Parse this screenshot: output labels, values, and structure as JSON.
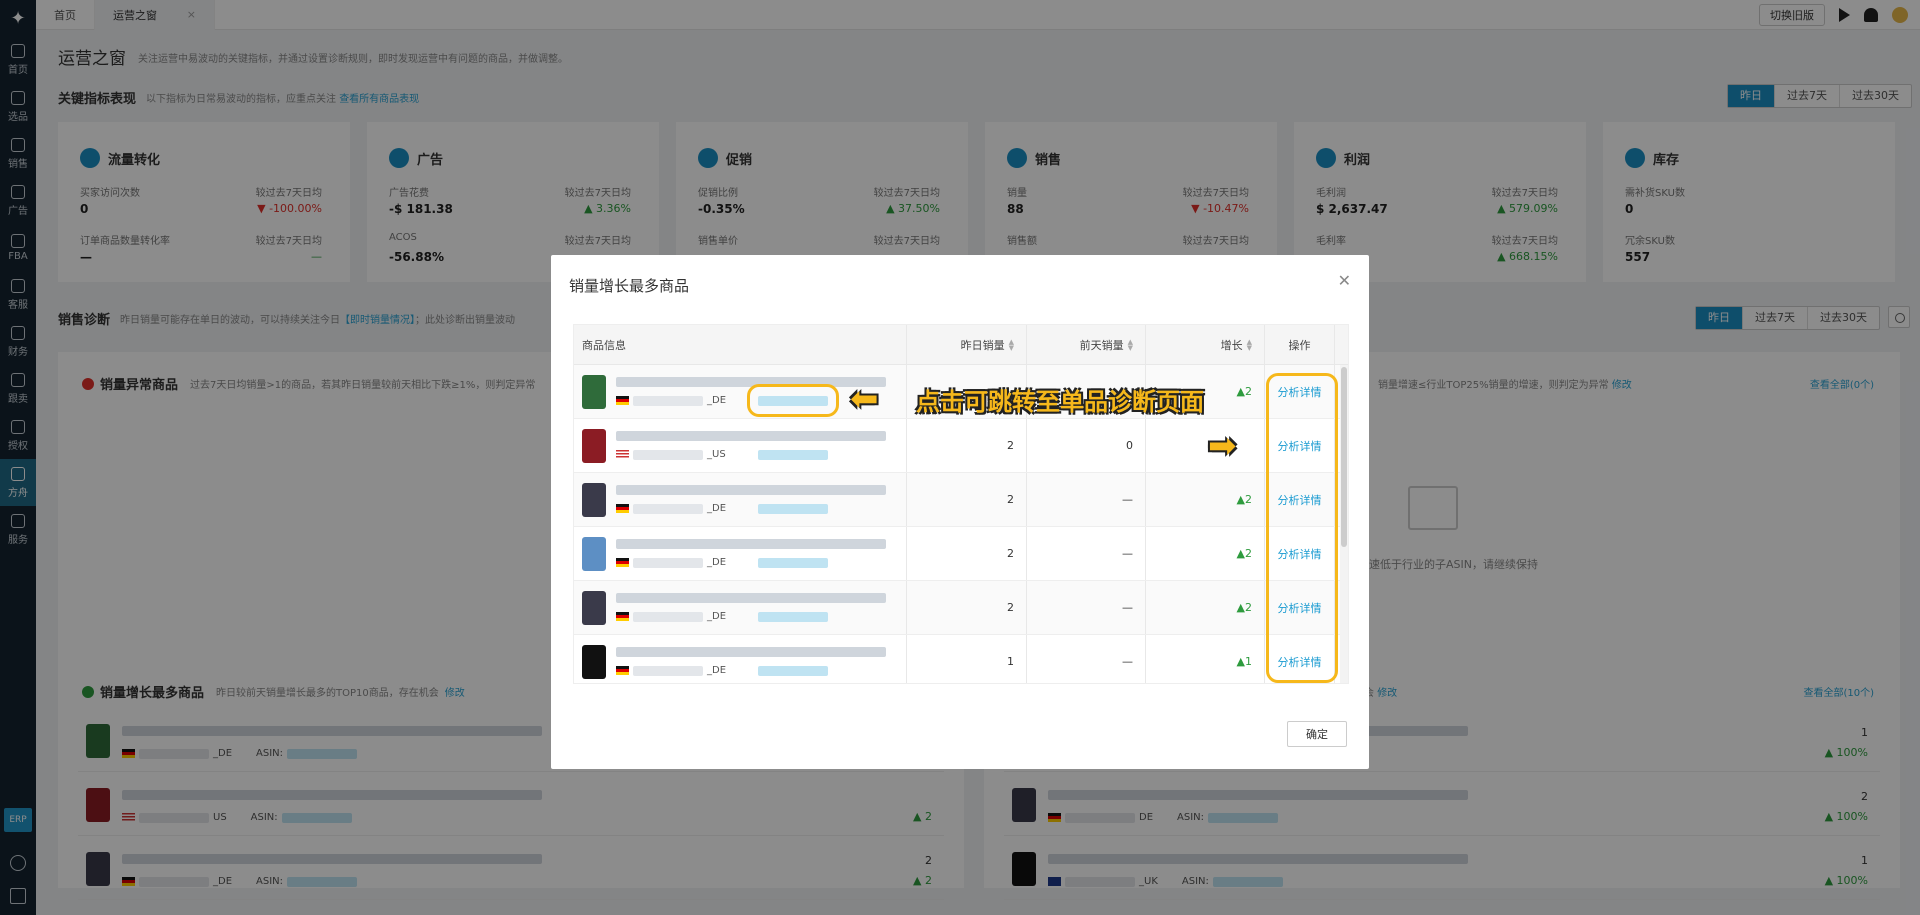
{
  "nav": {
    "items": [
      {
        "label": "首页"
      },
      {
        "label": "选品"
      },
      {
        "label": "销售"
      },
      {
        "label": "广告"
      },
      {
        "label": "FBA"
      },
      {
        "label": "客服"
      },
      {
        "label": "财务"
      },
      {
        "label": "跟卖"
      },
      {
        "label": "授权"
      },
      {
        "label": "方舟"
      },
      {
        "label": "服务"
      }
    ],
    "erp": "ERP"
  },
  "tabs": [
    {
      "label": "首页"
    },
    {
      "label": "运营之窗"
    }
  ],
  "topbar": {
    "switch_label": "切换旧版"
  },
  "page": {
    "title": "运营之窗",
    "desc": "关注运营中易波动的关键指标，并通过设置诊断规则，即时发现运营中有问题的商品，并做调整。"
  },
  "kpi_section": {
    "title": "关键指标表现",
    "desc": "以下指标为日常易波动的指标，应重点关注",
    "link": "查看所有商品表现",
    "periods": [
      "昨日",
      "过去7天",
      "过去30天"
    ]
  },
  "kpis": [
    {
      "name": "流量转化",
      "icon": "traffic-icon",
      "r1l": "买家访问次数",
      "r1r": "较过去7天日均",
      "v1": "0",
      "c1": "-100.00%",
      "c1dir": "down",
      "r2l": "订单商品数量转化率",
      "r2r": "较过去7天日均",
      "v2": "—",
      "c2": "—"
    },
    {
      "name": "广告",
      "icon": "ad-icon",
      "r1l": "广告花费",
      "r1r": "较过去7天日均",
      "v1": "-$ 181.38",
      "c1": "3.36%",
      "c1dir": "up",
      "r2l": "ACOS",
      "r2r": "较过去7天日均",
      "v2": "-56.88%",
      "c2": ""
    },
    {
      "name": "促销",
      "icon": "promo-icon",
      "r1l": "促销比例",
      "r1r": "较过去7天日均",
      "v1": "-0.35%",
      "c1": "37.50%",
      "c1dir": "up",
      "r2l": "销售单价",
      "r2r": "较过去7天日均",
      "v2": "",
      "c2": ""
    },
    {
      "name": "销售",
      "icon": "sale-icon",
      "r1l": "销量",
      "r1r": "较过去7天日均",
      "v1": "88",
      "c1": "-10.47%",
      "c1dir": "down",
      "r2l": "销售额",
      "r2r": "较过去7天日均",
      "v2": "",
      "c2": ""
    },
    {
      "name": "利润",
      "icon": "profit-icon",
      "r1l": "毛利润",
      "r1r": "较过去7天日均",
      "v1": "$ 2,637.47",
      "c1": "579.09%",
      "c1dir": "up",
      "r2l": "毛利率",
      "r2r": "较过去7天日均",
      "v2": "",
      "c2": "668.15%"
    },
    {
      "name": "库存",
      "icon": "inventory-icon",
      "r1l": "需补货SKU数",
      "r1r": "",
      "v1": "0",
      "c1": "",
      "c1dir": "",
      "r2l": "冗余SKU数",
      "r2r": "",
      "v2": "557",
      "c2": ""
    }
  ],
  "diag_section": {
    "title": "销售诊断",
    "desc": "昨日销量可能存在单日的波动，可以持续关注今日",
    "link": "【即时销量情况】",
    "desc2": "；此处诊断出销量波动",
    "periods": [
      "昨日",
      "过去7天",
      "过去30天"
    ]
  },
  "abnormal": {
    "title": "销量异常商品",
    "desc": "过去7天日均销量>1的商品，若其昨日销量较前天相比下跌≥1%，则判定异常",
    "right_desc": "销量增速≤行业TOP25%销量的增速，则判定为异常",
    "modify": "修改",
    "view_all": "查看全部(0个)",
    "empty": "增速低于行业的子ASIN，请继续保持"
  },
  "growth": {
    "title": "销量增长最多商品",
    "desc": "昨日较前天销量增长最多的TOP10商品，存在机会",
    "modify": "修改",
    "right_desc": "机会",
    "view_all": "查看全部(10个)",
    "asin_label": "ASIN:"
  },
  "bg_rows_left": [
    {
      "market": "_DE",
      "flag": "de",
      "v": "",
      "g": ""
    },
    {
      "market": "US",
      "flag": "us",
      "v": "",
      "g": "2"
    },
    {
      "market": "_DE",
      "flag": "de",
      "v": "2",
      "g": "2"
    }
  ],
  "bg_rows_right": [
    {
      "market": "",
      "flag": "",
      "v": "1",
      "g": "100%"
    },
    {
      "market": "DE",
      "flag": "de",
      "v": "2",
      "g": "100%"
    },
    {
      "market": "_UK",
      "flag": "uk",
      "v": "1",
      "g": "100%"
    }
  ],
  "modal": {
    "title": "销量增长最多商品",
    "columns": [
      "商品信息",
      "昨日销量",
      "前天销量",
      "增长",
      "操作"
    ],
    "rows": [
      {
        "market": "_DE",
        "flag": "de",
        "yesterday": "",
        "before": "",
        "growth": "2",
        "action": "分析详情"
      },
      {
        "market": "_US",
        "flag": "us",
        "yesterday": "2",
        "before": "0",
        "growth": "",
        "action": "分析详情"
      },
      {
        "market": "_DE",
        "flag": "de",
        "yesterday": "2",
        "before": "—",
        "growth": "2",
        "action": "分析详情"
      },
      {
        "market": "_DE",
        "flag": "de",
        "yesterday": "2",
        "before": "—",
        "growth": "2",
        "action": "分析详情"
      },
      {
        "market": "_DE",
        "flag": "de",
        "yesterday": "2",
        "before": "—",
        "growth": "2",
        "action": "分析详情"
      },
      {
        "market": "_DE",
        "flag": "de",
        "yesterday": "1",
        "before": "—",
        "growth": "1",
        "action": "分析详情"
      }
    ],
    "ok": "确定"
  },
  "annotation": {
    "text": "点击可跳转至单品诊断页面"
  },
  "colors": {
    "accent": "#1a8fc4",
    "annotation": "#f6b81b",
    "up": "#2e9b3e",
    "down": "#e0302a"
  }
}
